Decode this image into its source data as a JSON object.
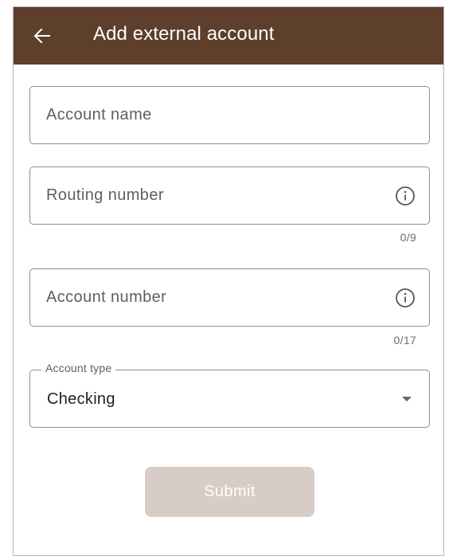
{
  "header": {
    "title": "Add external account",
    "back_icon": "arrow-left-icon",
    "color": "#5d3f2b"
  },
  "form": {
    "account_name": {
      "placeholder": "Account name",
      "value": ""
    },
    "routing_number": {
      "placeholder": "Routing number",
      "value": "",
      "counter": "0/9",
      "icon": "info-icon"
    },
    "account_number": {
      "placeholder": "Account number",
      "value": "",
      "counter": "0/17",
      "icon": "info-icon"
    },
    "account_type": {
      "label": "Account type",
      "selected": "Checking",
      "icon": "dropdown-arrow-icon"
    },
    "submit_label": "Submit",
    "submit_color": "#d8cdc6"
  }
}
